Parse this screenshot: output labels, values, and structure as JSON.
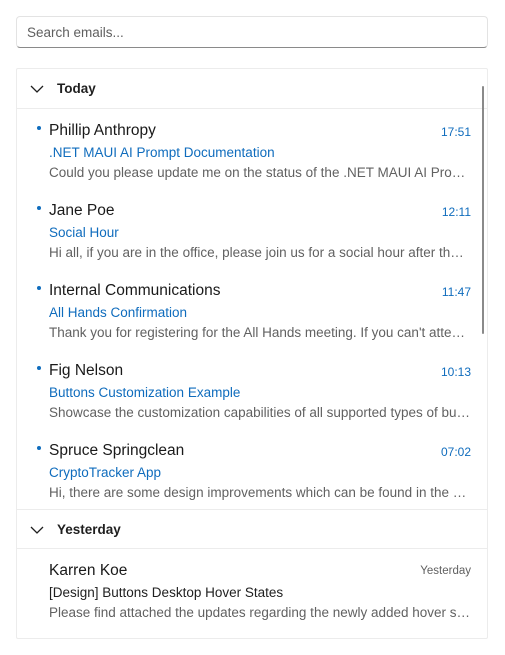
{
  "search": {
    "placeholder": "Search emails..."
  },
  "groups": [
    {
      "title": "Today",
      "emails": [
        {
          "sender": "Phillip Anthropy",
          "time": "17:51",
          "subject": ".NET MAUI AI Prompt Documentation",
          "preview": "Could you please update me on the status of the .NET MAUI AI Prompt documentation?"
        },
        {
          "sender": "Jane Poe",
          "time": "12:11",
          "subject": "Social Hour",
          "preview": "Hi all, if you are in the office, please join us for a social hour after the meeting."
        },
        {
          "sender": "Internal Communications",
          "time": "11:47",
          "subject": "All Hands Confirmation",
          "preview": "Thank you for registering for the All Hands meeting. If you can't attend, please let us know."
        },
        {
          "sender": "Fig Nelson",
          "time": "10:13",
          "subject": "Buttons Customization Example",
          "preview": "Showcase the customization capabilities of all supported types of buttons."
        },
        {
          "sender": "Spruce Springclean",
          "time": "07:02",
          "subject": "CryptoTracker App",
          "preview": "Hi, there are some design improvements which can be found in the attached file."
        }
      ]
    },
    {
      "title": "Yesterday",
      "emails": [
        {
          "sender": "Karren Koe",
          "time": "Yesterday",
          "subject": "[Design] Buttons Desktop Hover States",
          "preview": "Please find attached the updates regarding the newly added hover states for buttons."
        }
      ]
    }
  ],
  "colors": {
    "accent": "#0f6cbd",
    "muted": "#616161",
    "border": "#ececec"
  }
}
